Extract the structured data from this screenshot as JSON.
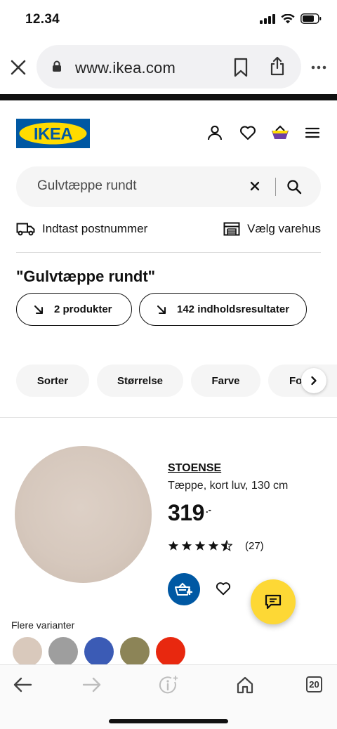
{
  "status_bar": {
    "time": "12.34"
  },
  "browser": {
    "url": "www.ikea.com"
  },
  "header": {
    "logo_text": "IKEA",
    "brand_colors": {
      "blue": "#0058a3",
      "yellow": "#ffdb00"
    }
  },
  "search": {
    "value": "Gulvtæppe rundt"
  },
  "delivery": {
    "postcode_label": "Indtast postnummer",
    "store_label": "Vælg varehus"
  },
  "results": {
    "heading": "\"Gulvtæppe rundt\"",
    "tabs": [
      {
        "label": "2 produkter"
      },
      {
        "label": "142 indholdsresultater"
      }
    ]
  },
  "filters": [
    {
      "label": "Sorter"
    },
    {
      "label": "Størrelse"
    },
    {
      "label": "Farve"
    },
    {
      "label": "Fo"
    }
  ],
  "product": {
    "name": "STOENSE",
    "description": "Tæppe, kort luv, 130 cm",
    "price": "319",
    "price_suffix": ".-",
    "rating": 4.5,
    "review_count": "(27)",
    "variants_label": "Flere varianter",
    "variants": [
      {
        "color": "#d9c9bc"
      },
      {
        "color": "#9e9e9e"
      },
      {
        "color": "#3b5bb5"
      },
      {
        "color": "#8c8457"
      },
      {
        "color": "#e8280f"
      }
    ]
  },
  "toolbar": {
    "tabs_count": "20"
  }
}
